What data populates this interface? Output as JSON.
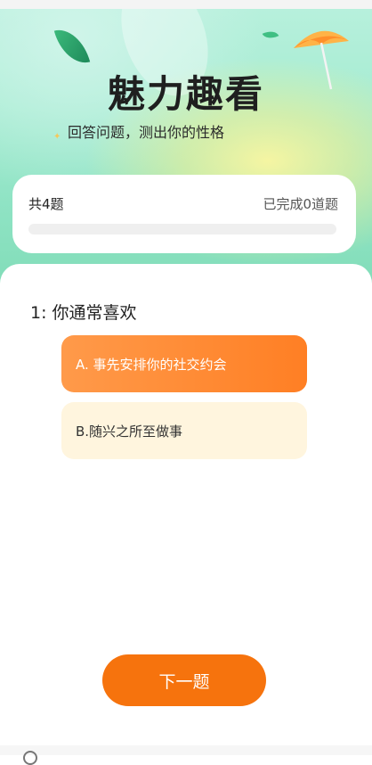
{
  "header": {
    "title": "魅力趣看",
    "subtitle": "回答问题，测出你的性格"
  },
  "progress": {
    "total_label": "共4题",
    "completed_label": "已完成0道题",
    "fraction": 0
  },
  "question": {
    "text": "1: 你通常喜欢",
    "options": [
      {
        "label": "A. 事先安排你的社交约会",
        "selected": true
      },
      {
        "label": "B.随兴之所至做事",
        "selected": false
      }
    ]
  },
  "next_button": {
    "label": "下一题"
  },
  "colors": {
    "accent": "#f6730d",
    "option_selected": "#ff8a2b",
    "option_unselected": "#fff5de",
    "hero_green": "#a6ecd2"
  }
}
